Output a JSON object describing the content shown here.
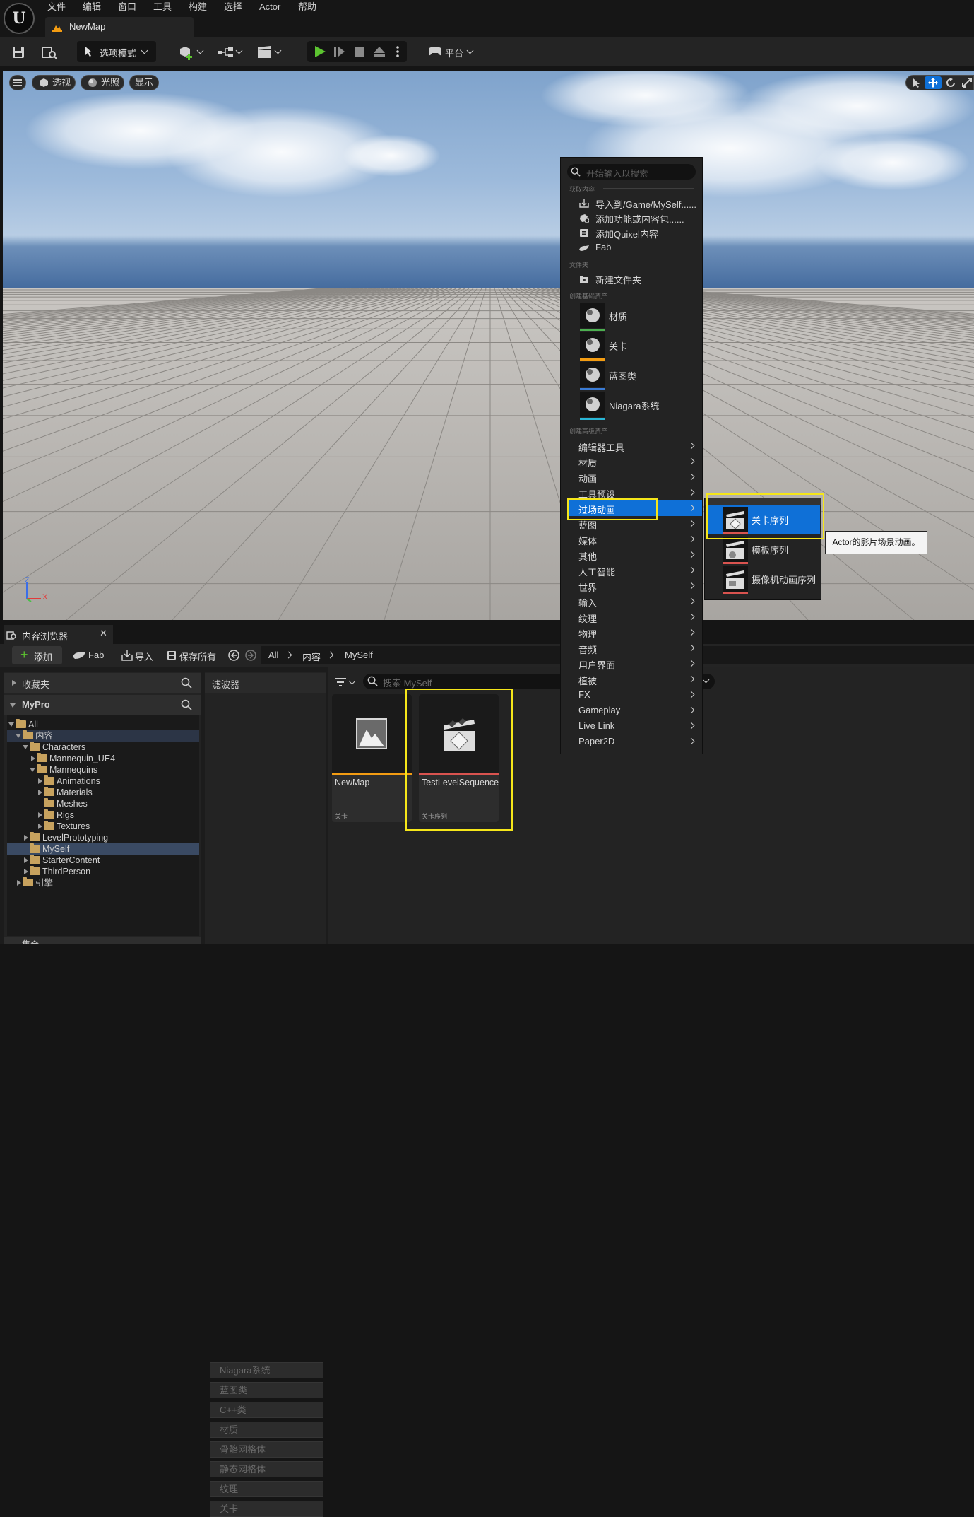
{
  "menubar": {
    "logo": "U",
    "items": [
      "文件",
      "编辑",
      "窗口",
      "工具",
      "构建",
      "选择",
      "Actor",
      "帮助"
    ],
    "map_tab": "NewMap"
  },
  "toolbar": {
    "mode_label": "选项模式",
    "platform_label": "平台"
  },
  "viewport": {
    "view_mode": "透视",
    "lighting": "光照",
    "show": "显示",
    "axis_z": "Z",
    "axis_x": "X"
  },
  "context_menu": {
    "search_placeholder": "开始输入以搜索",
    "section_get": "获取内容",
    "get_items": [
      "导入到/Game/MySelf......",
      "添加功能或内容包......",
      "添加Quixel内容",
      "Fab"
    ],
    "section_folder": "文件夹",
    "new_folder": "新建文件夹",
    "section_basic": "创建基础资产",
    "basic_assets": [
      {
        "label": "材质",
        "color": "#4caf50",
        "icon": "material-icon"
      },
      {
        "label": "关卡",
        "color": "#f39c12",
        "icon": "level-icon"
      },
      {
        "label": "蓝图类",
        "color": "#3a7bd5",
        "icon": "blueprint-icon"
      },
      {
        "label": "Niagara系统",
        "color": "#29b6d6",
        "icon": "niagara-icon"
      }
    ],
    "section_advanced": "创建高级资产",
    "advanced": [
      "编辑器工具",
      "材质",
      "动画",
      "工具预设",
      "过场动画",
      "蓝图",
      "媒体",
      "其他",
      "人工智能",
      "世界",
      "输入",
      "纹理",
      "物理",
      "音频",
      "用户界面",
      "植被",
      "FX",
      "Gameplay",
      "Live Link",
      "Paper2D"
    ],
    "highlighted": "过场动画"
  },
  "submenu": {
    "items": [
      "关卡序列",
      "模板序列",
      "摄像机动画序列"
    ],
    "tooltip": "Actor的影片场景动画。"
  },
  "content_browser": {
    "tab_title": "内容浏览器",
    "add_label": "添加",
    "fab_label": "Fab",
    "import_label": "导入",
    "save_all_label": "保存所有",
    "breadcrumb": [
      "All",
      "内容",
      "MySelf"
    ],
    "favorites": "收藏夹",
    "project": "MyPro",
    "collections": "集合",
    "tree": [
      {
        "label": "All",
        "depth": 0,
        "exp": "open"
      },
      {
        "label": "内容",
        "depth": 1,
        "exp": "open"
      },
      {
        "label": "Characters",
        "depth": 2,
        "exp": "open"
      },
      {
        "label": "Mannequin_UE4",
        "depth": 3,
        "exp": "closed"
      },
      {
        "label": "Mannequins",
        "depth": 3,
        "exp": "open"
      },
      {
        "label": "Animations",
        "depth": 4,
        "exp": "closed"
      },
      {
        "label": "Materials",
        "depth": 4,
        "exp": "closed"
      },
      {
        "label": "Meshes",
        "depth": 4,
        "exp": "none"
      },
      {
        "label": "Rigs",
        "depth": 4,
        "exp": "closed"
      },
      {
        "label": "Textures",
        "depth": 4,
        "exp": "closed"
      },
      {
        "label": "LevelPrototyping",
        "depth": 2,
        "exp": "closed"
      },
      {
        "label": "MySelf",
        "depth": 2,
        "exp": "none",
        "selected": true
      },
      {
        "label": "StarterContent",
        "depth": 2,
        "exp": "closed"
      },
      {
        "label": "ThirdPerson",
        "depth": 2,
        "exp": "closed"
      },
      {
        "label": "引擎",
        "depth": 1,
        "exp": "closed"
      }
    ],
    "filters_title": "滤波器",
    "filters": [
      "Niagara系统",
      "蓝图类",
      "C++类",
      "材质",
      "骨骼网格体",
      "静态网格体",
      "纹理",
      "关卡"
    ],
    "search_placeholder": "搜索 MySelf",
    "assets": [
      {
        "name": "NewMap",
        "type": "关卡",
        "color": "#f39c12"
      },
      {
        "name": "TestLevelSequence",
        "type": "关卡序列",
        "color": "#d9534f"
      }
    ]
  },
  "colors": {
    "accent": "#0f70d7",
    "highlight_box": "#f5e61a",
    "play": "#5cc430"
  }
}
